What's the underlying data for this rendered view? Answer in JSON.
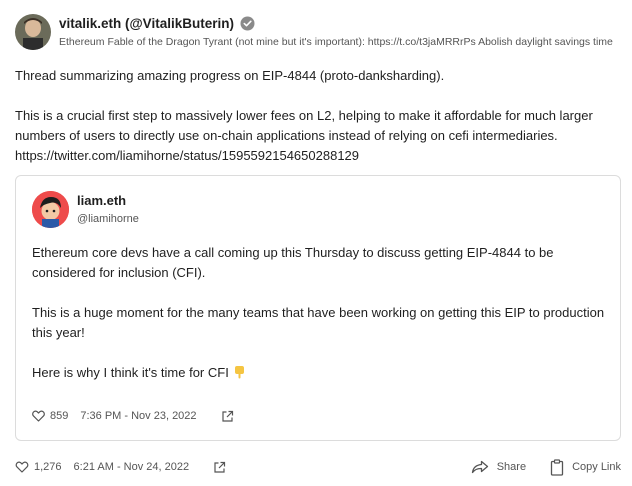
{
  "author": {
    "name_line": "vitalik.eth (@VitalikButerin)",
    "bio": "Ethereum Fable of the Dragon Tyrant (not mine but it's important): https://t.co/t3jaMRRrPs Abolish daylight savings time"
  },
  "tweet": {
    "paragraphs": [
      "Thread summarizing amazing progress on EIP-4844 (proto-danksharding).",
      "This is a crucial first step to massively lower fees on L2, helping to make it affordable for much larger numbers of users to directly use on-chain applications instead of relying on cefi intermediaries. https://twitter.com/liamihorne/status/1595592154650288129"
    ],
    "likes": "1,276",
    "timestamp": "6:21 AM - Nov 24, 2022"
  },
  "quoted": {
    "name": "liam.eth",
    "handle": "@liamihorne",
    "paragraphs": [
      "Ethereum core devs have a call coming up this Thursday to discuss getting EIP-4844 to be considered for inclusion (CFI).",
      "This is a huge moment for the many teams that have been working on getting this EIP to production this year!",
      "Here is why I think it's time for CFI"
    ],
    "likes": "859",
    "timestamp": "7:36 PM - Nov 23, 2022"
  },
  "actions": {
    "share": "Share",
    "copy_link": "Copy Link"
  },
  "icons": {
    "verified": "verified-badge-icon",
    "like": "heart-icon",
    "external": "external-link-icon",
    "share": "share-arrow-icon",
    "copy": "clipboard-icon",
    "emoji": "pointing-down-emoji"
  },
  "colors": {
    "text": "#1f1f1f",
    "muted": "#555555",
    "border": "#dcdcdc",
    "emoji": "#f5c542"
  }
}
